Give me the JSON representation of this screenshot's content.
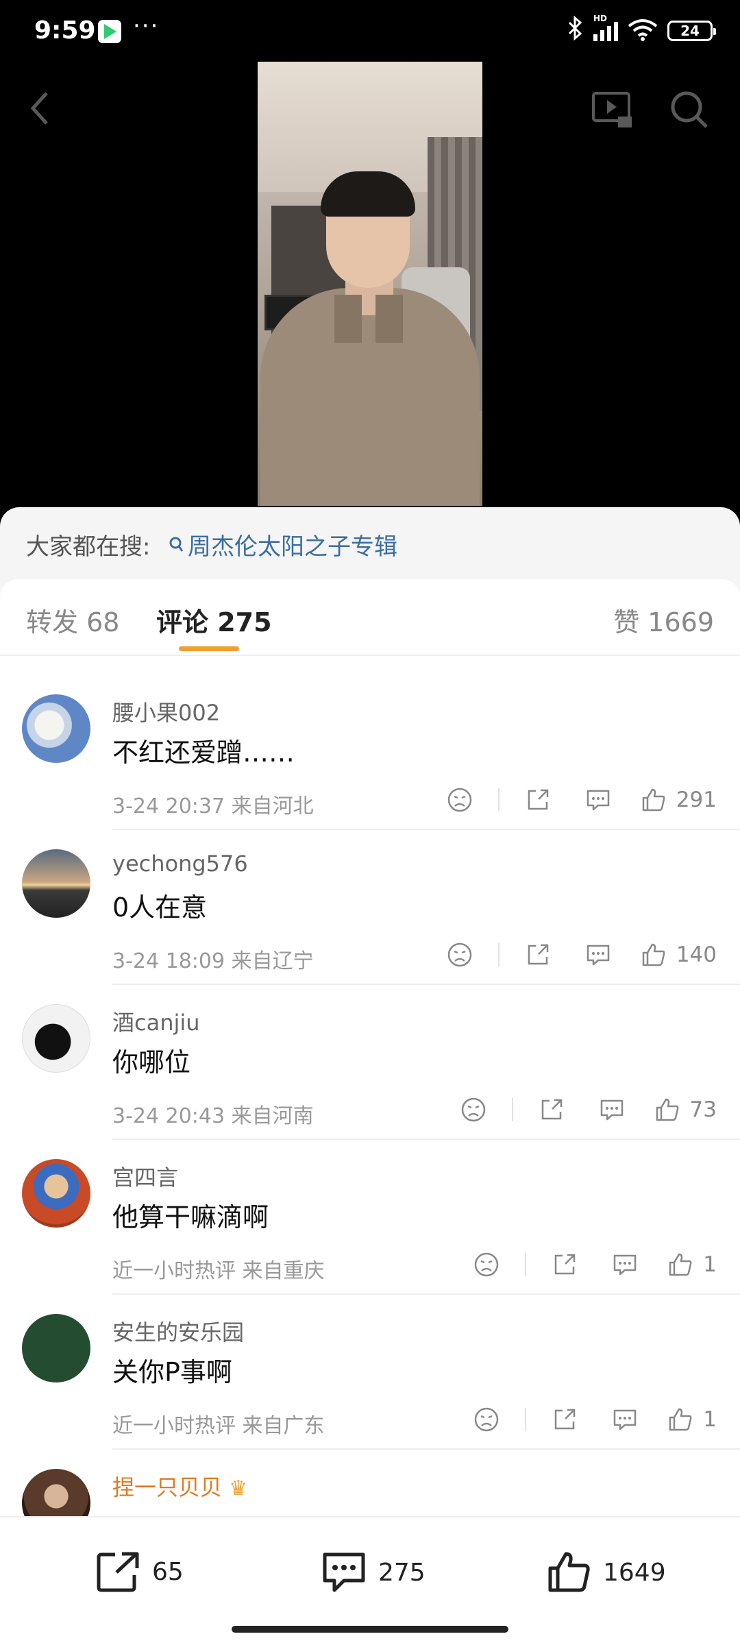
{
  "status": {
    "time": "9:59",
    "dots": "···",
    "hd": "HD",
    "battery": "24"
  },
  "search": {
    "label": "大家都在搜:",
    "term": "周杰伦太阳之子专辑"
  },
  "tabs": {
    "repost": "转发 68",
    "comments": "评论 275",
    "likes": "赞 1669"
  },
  "comments": [
    {
      "user": "腰小果002",
      "text": "不红还爱蹭……",
      "time": "3-24 20:37",
      "location": "来自河北",
      "likes": "291"
    },
    {
      "user": "yechong576",
      "text": "0人在意",
      "time": "3-24 18:09",
      "location": "来自辽宁",
      "likes": "140"
    },
    {
      "user": "酒canjiu",
      "text": "你哪位",
      "time": "3-24 20:43",
      "location": "来自河南",
      "likes": "73"
    },
    {
      "user": "宫四言",
      "text": "他算干嘛滴啊",
      "time": "近一小时热评",
      "location": "来自重庆",
      "likes": "1"
    },
    {
      "user": "安生的安乐园",
      "text": "关你P事啊",
      "time": "近一小时热评",
      "location": "来自广东",
      "likes": "1"
    }
  ],
  "partial_comment": {
    "user": "捏一只贝贝"
  },
  "bottom_bar": {
    "reposts": "65",
    "comments": "275",
    "likes": "1649"
  },
  "colors": {
    "accent": "#f0a02e",
    "link": "#3b6da0",
    "vip_name": "#e07a1f"
  }
}
